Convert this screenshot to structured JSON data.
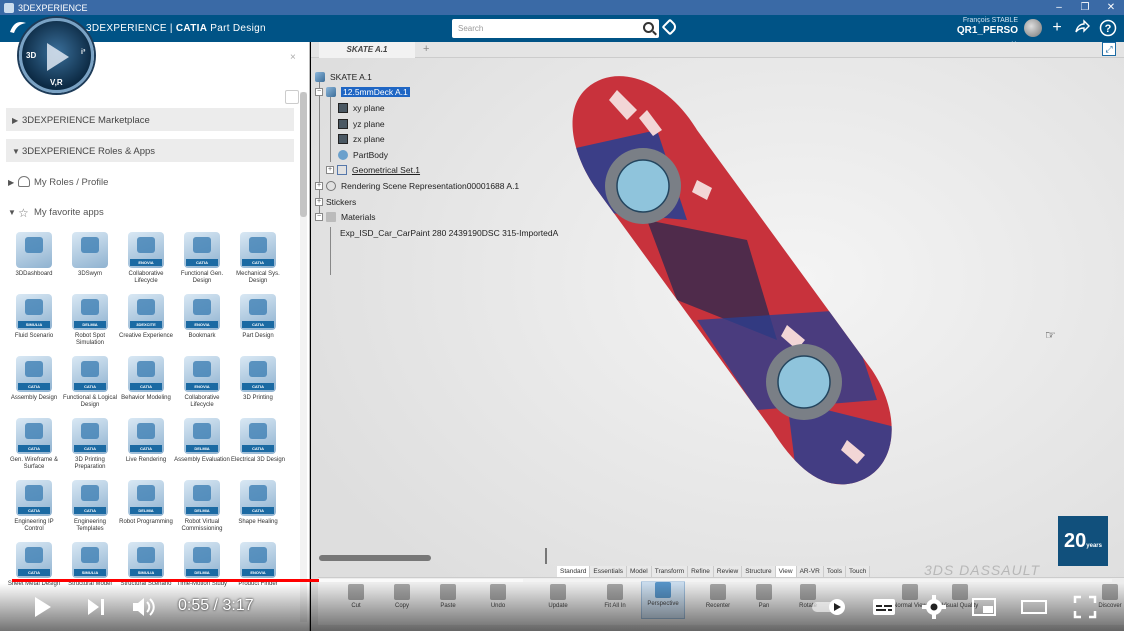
{
  "os_window": {
    "title": "3DEXPERIENCE",
    "buttons": [
      "–",
      "❐",
      "✕"
    ]
  },
  "topbar": {
    "brand_prefix": "3DEXPERIENCE | ",
    "brand_catia": "CATIA",
    "brand_app": " Part Design",
    "search_placeholder": "Search",
    "user_name": "François STABLE",
    "tenant": "QR1_PERSO ⌄"
  },
  "compass": {
    "label_3d": "3D",
    "label_vr": "V,R",
    "label_i": "i³"
  },
  "left_panel": {
    "close": "×",
    "marketplace": "3DEXPERIENCE Marketplace",
    "roles_apps": "3DEXPERIENCE Roles & Apps",
    "my_roles": "My Roles / Profile",
    "favorite_apps": "My favorite apps",
    "apps": [
      {
        "name": "3DDashboard",
        "band": ""
      },
      {
        "name": "3DSwym",
        "band": ""
      },
      {
        "name": "Collaborative Lifecycle",
        "band": "ENOVIA"
      },
      {
        "name": "Functional Gen. Design",
        "band": "CATIA"
      },
      {
        "name": "Mechanical Sys. Design",
        "band": "CATIA"
      },
      {
        "name": "Fluid Scenario",
        "band": "SIMULIA"
      },
      {
        "name": "Robot Spot Simulation",
        "band": "DELMIA"
      },
      {
        "name": "Creative Experience",
        "band": "3DEXCITE"
      },
      {
        "name": "Bookmark",
        "band": "ENOVIA"
      },
      {
        "name": "Part Design",
        "band": "CATIA"
      },
      {
        "name": "Assembly Design",
        "band": "CATIA"
      },
      {
        "name": "Functional & Logical Design",
        "band": "CATIA"
      },
      {
        "name": "Behavior Modeling",
        "band": "CATIA"
      },
      {
        "name": "Collaborative Lifecycle",
        "band": "ENOVIA"
      },
      {
        "name": "3D Printing",
        "band": "CATIA"
      },
      {
        "name": "Gen. Wireframe & Surface",
        "band": "CATIA"
      },
      {
        "name": "3D Printing Preparation",
        "band": "CATIA"
      },
      {
        "name": "Live Rendering",
        "band": "CATIA"
      },
      {
        "name": "Assembly Evaluation",
        "band": "DELMIA"
      },
      {
        "name": "Electrical 3D Design",
        "band": "CATIA"
      },
      {
        "name": "Engineering IP Control",
        "band": "CATIA"
      },
      {
        "name": "Engineering Templates",
        "band": "CATIA"
      },
      {
        "name": "Robot Programming",
        "band": "DELMIA"
      },
      {
        "name": "Robot Virtual Commissioning",
        "band": "DELMIA"
      },
      {
        "name": "Shape Healing",
        "band": "CATIA"
      },
      {
        "name": "Sheet Metal Design",
        "band": "CATIA"
      },
      {
        "name": "Structural Model",
        "band": "SIMULIA"
      },
      {
        "name": "Structural Scenario",
        "band": "SIMULIA"
      },
      {
        "name": "Time-Motion Study",
        "band": "DELMIA"
      },
      {
        "name": "Product Finder",
        "band": "ENOVIA"
      }
    ]
  },
  "viewer": {
    "tab": "SKATE A.1",
    "add_tab": "+",
    "tree": {
      "root": "SKATE A.1",
      "part": "12.5mmDeck A.1",
      "xy": "xy plane",
      "yz": "yz plane",
      "zx": "zx plane",
      "partbody": "PartBody",
      "geoset": "Geometrical Set.1",
      "rendering": "Rendering Scene Representation00001688 A.1",
      "stickers": "Stickers",
      "materials": "Materials",
      "material_item": "Exp_ISD_Car_CarPaint 280 2439190DSC 315-ImportedA"
    },
    "logo20": "20",
    "logo20_sub": "years",
    "watermark": "3DS DASSAULT"
  },
  "action_bar": {
    "tabs": [
      "Standard",
      "Essentials",
      "Model",
      "Transform",
      "Refine",
      "Review",
      "Structure",
      "View",
      "AR-VR",
      "Tools",
      "Touch"
    ],
    "active_tab": "View",
    "actions": [
      {
        "label": "Cut",
        "icon": "scissors-icon"
      },
      {
        "label": "Copy",
        "icon": "copy-icon"
      },
      {
        "label": "Paste",
        "icon": "paste-icon"
      },
      {
        "label": "Undo",
        "icon": "undo-icon"
      },
      {
        "label": "Update",
        "icon": "update-icon"
      },
      {
        "label": "Fit All In",
        "icon": "fit-all-icon"
      },
      {
        "label": "Perspective",
        "icon": "perspective-icon"
      },
      {
        "label": "Recenter",
        "icon": "recenter-icon"
      },
      {
        "label": "Pan",
        "icon": "pan-icon"
      },
      {
        "label": "Rotate",
        "icon": "rotate-icon"
      },
      {
        "label": "Normal View",
        "icon": "normal-view-icon"
      },
      {
        "label": "Visual Quality",
        "icon": "visual-quality-icon"
      },
      {
        "label": "Discover",
        "icon": "discover-icon"
      }
    ]
  },
  "video_player": {
    "current_time": "0:55",
    "duration": "3:17",
    "time_display": "0:55 / 3:17",
    "played_fraction": 0.279,
    "buffered_fraction": 0.465
  },
  "colors": {
    "topbar": "#005386",
    "deck_red": "#c8323c",
    "deck_blue": "#2b3f8f",
    "progress_red": "#ff0000",
    "selection": "#1f66c4"
  }
}
